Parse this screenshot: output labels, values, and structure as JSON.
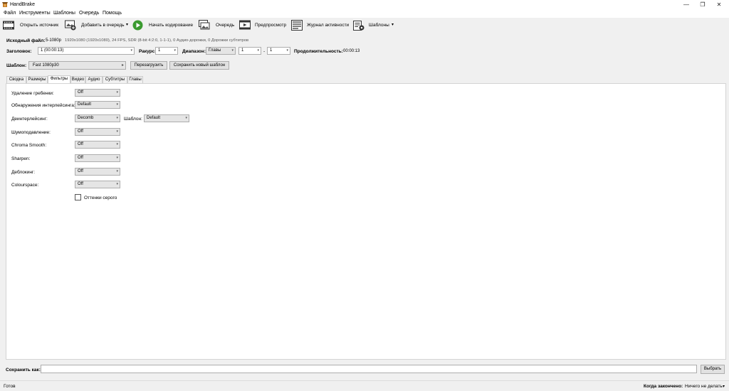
{
  "window": {
    "title": "HandBrake",
    "minimize": "—",
    "maximize": "❐",
    "close": "✕"
  },
  "menu": [
    "Файл",
    "Инструменты",
    "Шаблоны",
    "Очередь",
    "Помощь"
  ],
  "toolbar": {
    "open_source": "Открыть источник",
    "add_to_queue": "Добавить в очередь",
    "start_encode": "Начать кодирование",
    "queue": "Очередь",
    "preview": "Предпросмотр",
    "activity_log": "Журнал активности",
    "presets": "Шаблоны",
    "dropdown_arrow": "▾"
  },
  "source": {
    "label": "Исходный файл:",
    "name": "5-1080p",
    "info": "1920x1080 (1920x1080), 24 FPS, SDR (8-bit 4:2:0, 1-1-1), 0 Аудио-дорожки, 0 Дорожки субтитров"
  },
  "title_row": {
    "title_label": "Заголовок:",
    "title_value": "1 (00:00:13)",
    "angle_label": "Ракурс:",
    "angle_value": "1",
    "range_label": "Диапазон:",
    "range_type": "Главы",
    "range_from": "1",
    "range_sep": "-",
    "range_to": "1",
    "duration_label": "Продолжительность:",
    "duration_value": "00:00:13"
  },
  "preset_row": {
    "label": "Шаблон:",
    "value": "Fast 1080p30",
    "arrow": "▸",
    "reload": "Перезагрузить",
    "save_new": "Сохранить новый шаблон"
  },
  "tabs": [
    "Сводка",
    "Размеры",
    "Фильтры",
    "Видео",
    "Аудио",
    "Субтитры",
    "Главы"
  ],
  "filters": {
    "rows": [
      {
        "label": "Удаление гребенки:",
        "value": "Off"
      },
      {
        "label": "Обнаружения интерлейсинга:",
        "value": "Default"
      },
      {
        "label": "Деинтерлейсинг:",
        "value": "Decomb"
      },
      {
        "label": "Шумоподавление:",
        "value": "Off"
      },
      {
        "label": "Chroma Smooth:",
        "value": "Off"
      },
      {
        "label": "Sharpen:",
        "value": "Off"
      },
      {
        "label": "Деблокинг:",
        "value": "Off"
      },
      {
        "label": "Colourspace:",
        "value": "Off"
      }
    ],
    "deinterlace_preset_label": "Шаблон:",
    "deinterlace_preset_value": "Default",
    "grayscale_label": "Оттенки серого",
    "arrow": "▾"
  },
  "save": {
    "label": "Сохранить как:",
    "value": "",
    "browse": "Выбрать"
  },
  "status": {
    "text": "Готов",
    "when_done_label": "Когда закончено:",
    "when_done_value": "Ничего не делать",
    "arrow": "▾"
  },
  "colors": {
    "start_green": "#3a9a2f",
    "accent": "#f0f0f0"
  }
}
